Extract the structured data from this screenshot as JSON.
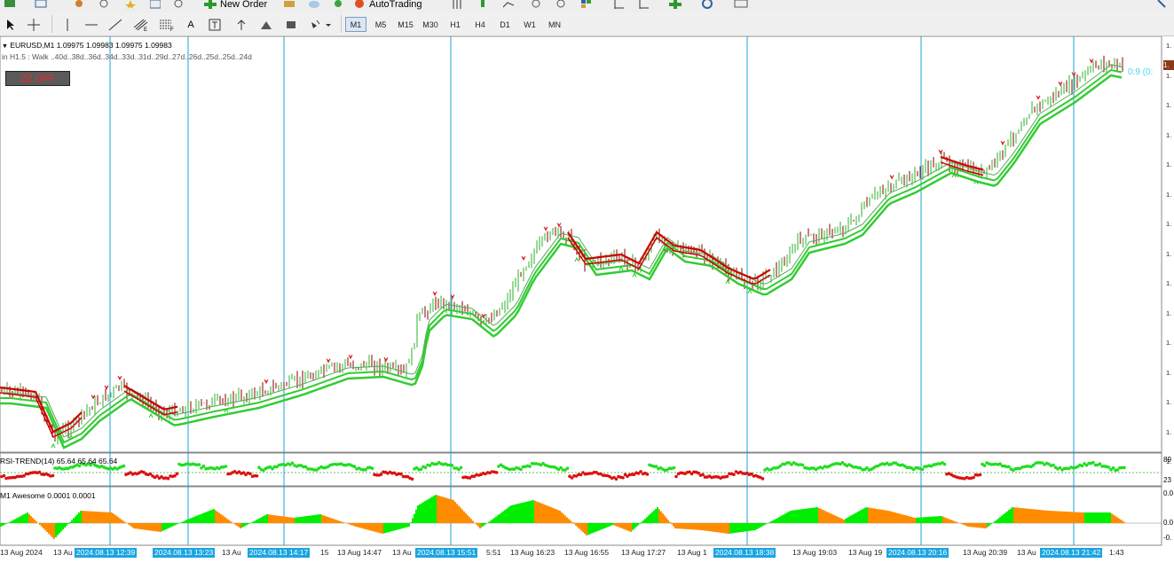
{
  "toolbar": {
    "new_order_label": "New Order",
    "autotrading_label": "AutoTrading",
    "timeframes": [
      "M1",
      "M5",
      "M15",
      "M30",
      "H1",
      "H4",
      "D1",
      "W1",
      "MN"
    ],
    "active_timeframe": "M1",
    "text_tool_label": "A"
  },
  "chart": {
    "symbol_info": "EURUSD,M1  1.09975 1.09983 1.09975 1.09983",
    "info_line": "in H1.5 :   Walk ..40d..38d..36d..34d..33d..31d..29d..27d..26d..25d..25d..24d",
    "zz_button": "ZZ OFF",
    "zz_readout": "0:9 (0:",
    "price_badge": "1.",
    "price_ticks": [
      "1.",
      "1.",
      "1.",
      "1.",
      "1.",
      "1.",
      "1.",
      "1.",
      "1.",
      "1.",
      "1.",
      "1.",
      "1.",
      "1.",
      "1."
    ]
  },
  "rsi_panel": {
    "label": "RSI-TREND(14) 65.64 65.64 65.64",
    "level_high": "89",
    "level_low": "23"
  },
  "ao_panel": {
    "label": "M1 Awesome 0.0001 0.0001",
    "tick_top": "0.0",
    "tick_mid": "0.0",
    "tick_bottom": "-0."
  },
  "time_axis": {
    "labels": [
      "13 Aug 2024",
      "13 Au",
      "13 Au",
      "13 Aug 14:47",
      "13 Au",
      "15",
      "5:51",
      "13 Aug 16:23",
      "13 Aug 16:55",
      "13 Aug 17:27",
      "13 Aug 1",
      "13 Aug 19:03",
      "13 Aug 19",
      "13 Aug 20:39",
      "13 Au",
      "1:43"
    ],
    "cursor_boxes": [
      "2024.08.13 12:39",
      "2024.08.13 13:23",
      "2024.08.13 14:17",
      "2024.08.13 15:51",
      "2024.08.13 18:38",
      "2024.08.13 20:16",
      "2024.08.13 21:42"
    ]
  },
  "colors": {
    "bull": "#2db22d",
    "bear": "#8b0000",
    "ma_red": "#cc0000",
    "ma_green": "#33cc33",
    "vline": "#1ea0d8",
    "ao_green": "#00ee00",
    "ao_orange": "#ff8c00",
    "rsi_green": "#22dd22",
    "rsi_red": "#dd1111"
  }
}
